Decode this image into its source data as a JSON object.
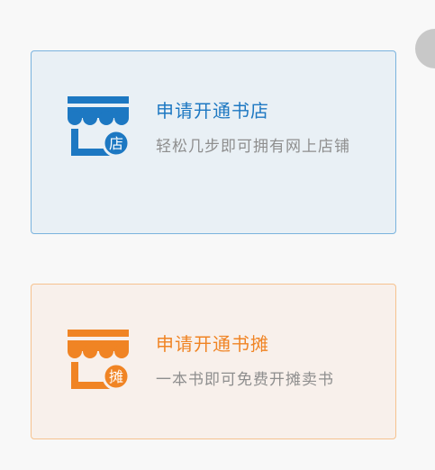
{
  "options": [
    {
      "title": "申请开通书店",
      "description": "轻松几步即可拥有网上店铺",
      "badge": "店",
      "icon": "storefront-icon",
      "accent": "#1d78c2",
      "background": "#e9f0f5",
      "border": "#7ab3de"
    },
    {
      "title": "申请开通书摊",
      "description": "一本书即可免费开摊卖书",
      "badge": "摊",
      "icon": "stall-icon",
      "accent": "#f08424",
      "background": "#f8f0eb",
      "border": "#f6c28f"
    }
  ]
}
